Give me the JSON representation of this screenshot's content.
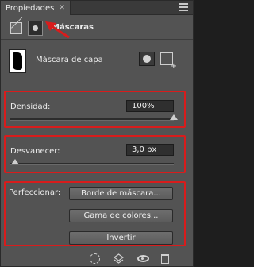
{
  "panel": {
    "tab_label": "Propiedades",
    "header_title": "Máscaras",
    "mask_label": "Máscara de capa"
  },
  "density": {
    "label": "Densidad:",
    "value": "100%",
    "level": 1.0
  },
  "feather": {
    "label": "Desvanecer:",
    "value": "3,0 px",
    "level": 0.03
  },
  "refine": {
    "label": "Perfeccionar:",
    "buttons": [
      "Borde de máscara...",
      "Gama de colores...",
      "Invertir"
    ]
  },
  "colors": {
    "panel_bg": "#535353",
    "annotation_red": "#d81c1c"
  },
  "icons": {
    "adjustments": "adjustments-icon",
    "mask_mode": "mask-mode-icon",
    "pixel_mask": "pixel-mask-icon",
    "vector_mask": "vector-mask-icon",
    "load_selection": "load-selection-icon",
    "apply_mask": "apply-mask-icon",
    "visibility": "eye-icon",
    "delete": "trash-icon"
  }
}
